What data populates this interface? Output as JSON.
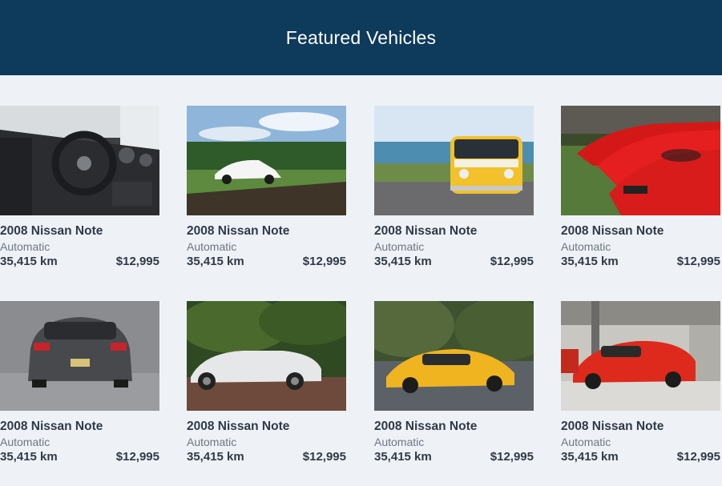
{
  "header": {
    "title": "Featured Vehicles"
  },
  "colors": {
    "header_bg": "#0e3a5b",
    "page_bg": "#eef2f7",
    "text": "#2f3a46",
    "muted": "#6d7680"
  },
  "vehicles": [
    {
      "image": "car-interior-photo",
      "title": "2008 Nissan Note",
      "transmission": "Automatic",
      "km": "35,415 km",
      "price": "$12,995"
    },
    {
      "image": "white-tesla-photo",
      "title": "2008 Nissan Note",
      "transmission": "Automatic",
      "km": "35,415 km",
      "price": "$12,995"
    },
    {
      "image": "yellow-vw-bus-photo",
      "title": "2008 Nissan Note",
      "transmission": "Automatic",
      "km": "35,415 km",
      "price": "$12,995"
    },
    {
      "image": "red-ferraris-photo",
      "title": "2008 Nissan Note",
      "transmission": "Automatic",
      "km": "35,415 km",
      "price": "$12,995"
    },
    {
      "image": "grey-mustang-rear-photo",
      "title": "2008 Nissan Note",
      "transmission": "Automatic",
      "km": "35,415 km",
      "price": "$12,995"
    },
    {
      "image": "white-convertible-photo",
      "title": "2008 Nissan Note",
      "transmission": "Automatic",
      "km": "35,415 km",
      "price": "$12,995"
    },
    {
      "image": "yellow-supercar-photo",
      "title": "2008 Nissan Note",
      "transmission": "Automatic",
      "km": "35,415 km",
      "price": "$12,995"
    },
    {
      "image": "red-ferrari-garage-photo",
      "title": "2008 Nissan Note",
      "transmission": "Automatic",
      "km": "35,415 km",
      "price": "$12,995"
    }
  ]
}
